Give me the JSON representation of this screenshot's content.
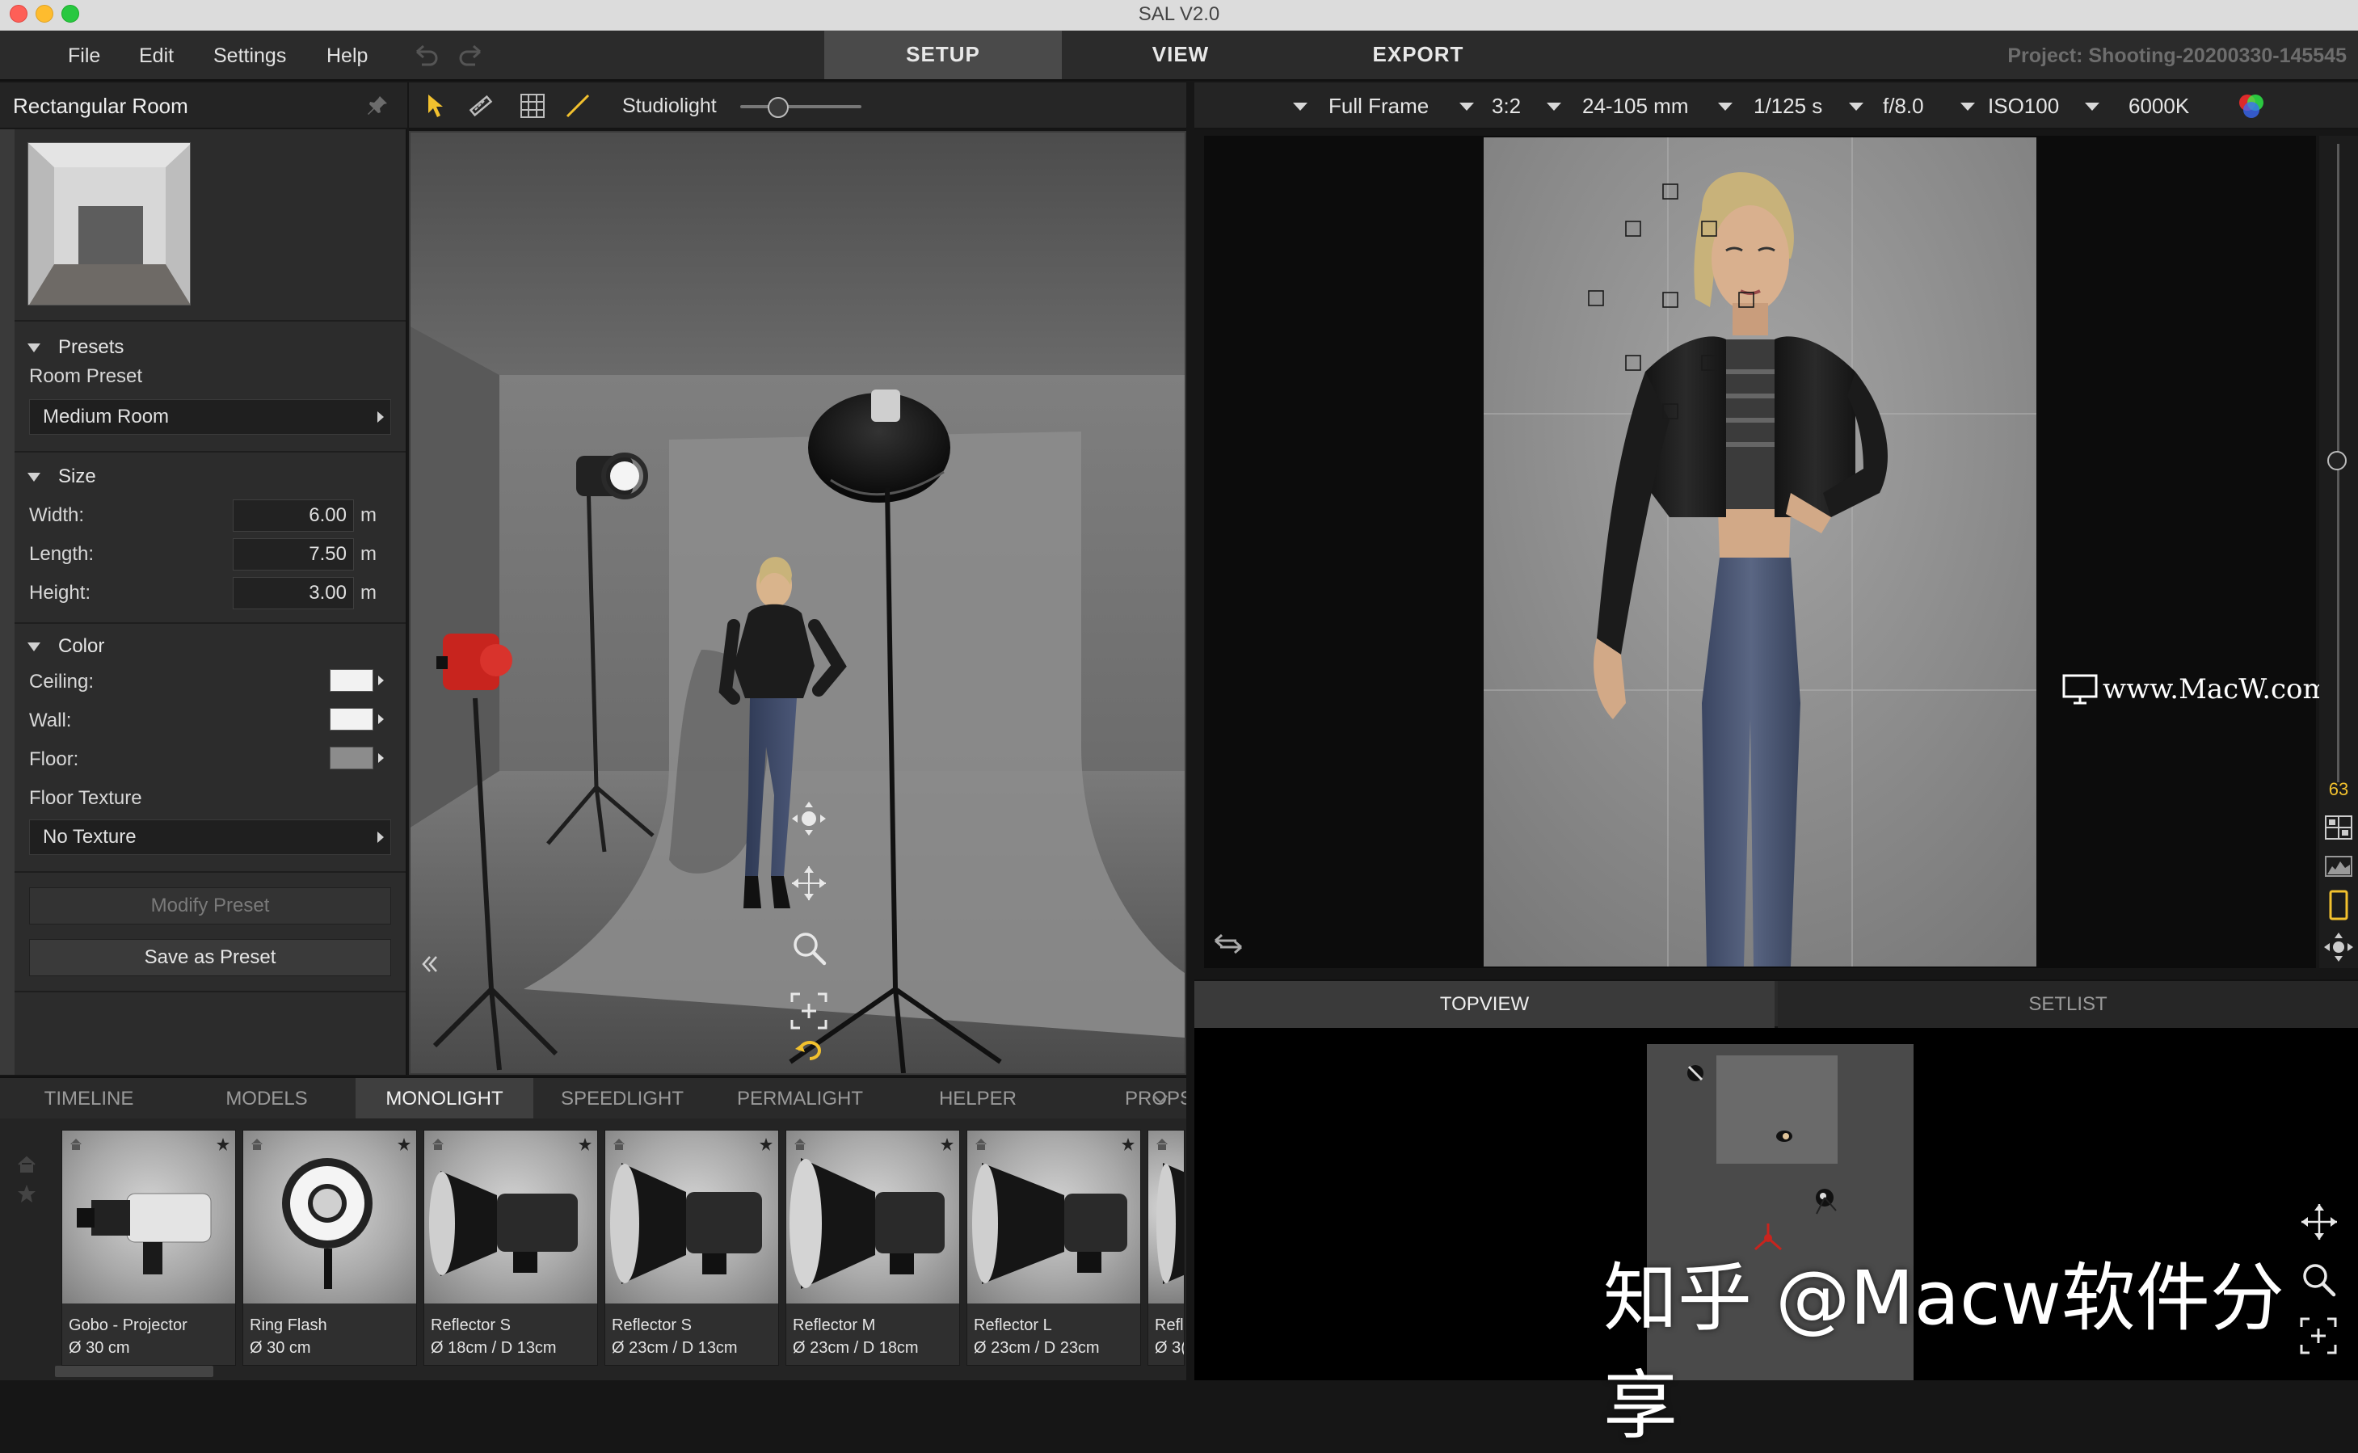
{
  "window": {
    "title": "SAL V2.0"
  },
  "menu": {
    "file": "File",
    "edit": "Edit",
    "settings": "Settings",
    "help": "Help"
  },
  "modes": {
    "setup": "SETUP",
    "view": "VIEW",
    "export": "EXPORT",
    "active": "SETUP"
  },
  "project": "Project: Shooting-20200330-145545",
  "left_panel": {
    "title": "Rectangular Room",
    "presets": {
      "header": "Presets",
      "room_preset_label": "Room Preset",
      "room_preset_value": "Medium Room"
    },
    "size": {
      "header": "Size",
      "width_label": "Width:",
      "width_value": "6.00",
      "length_label": "Length:",
      "length_value": "7.50",
      "height_label": "Height:",
      "height_value": "3.00",
      "unit": "m"
    },
    "color": {
      "header": "Color",
      "ceiling_label": "Ceiling:",
      "ceiling_color": "#f2f2f2",
      "wall_label": "Wall:",
      "wall_color": "#f2f2f2",
      "floor_label": "Floor:",
      "floor_color": "#8c8c8c",
      "floor_texture_label": "Floor Texture",
      "floor_texture_value": "No Texture"
    },
    "modify_preset": "Modify Preset",
    "save_preset": "Save as Preset"
  },
  "viewport_toolbar": {
    "studiolight_label": "Studiolight",
    "studiolight_level": 0.3
  },
  "camera": {
    "sensor": "Full Frame",
    "aspect": "3:2",
    "lens": "24-105 mm",
    "shutter": "1/125 s",
    "aperture": "f/8.0",
    "iso": "ISO100",
    "white_balance": "6000K",
    "focal_readout": "63"
  },
  "bottom_right_tabs": {
    "topview": "TOPVIEW",
    "setlist": "SETLIST"
  },
  "library_tabs": [
    "TIMELINE",
    "MODELS",
    "MONOLIGHT",
    "SPEEDLIGHT",
    "PERMALIGHT",
    "HELPER",
    "PROPS"
  ],
  "library_active_tab": "MONOLIGHT",
  "library_items": [
    {
      "name": "Gobo - Projector",
      "size": "Ø 30 cm"
    },
    {
      "name": "Ring Flash",
      "size": "Ø 30 cm"
    },
    {
      "name": "Reflector S",
      "size": "Ø 18cm / D 13cm"
    },
    {
      "name": "Reflector S",
      "size": "Ø 23cm / D 13cm"
    },
    {
      "name": "Reflector M",
      "size": "Ø 23cm / D 18cm"
    },
    {
      "name": "Reflector L",
      "size": "Ø 23cm / D 23cm"
    },
    {
      "name": "Refl",
      "size": "Ø 3("
    }
  ],
  "watermarks": {
    "site": "www.MacW.com",
    "cn": "知乎 @Macw软件分享"
  }
}
